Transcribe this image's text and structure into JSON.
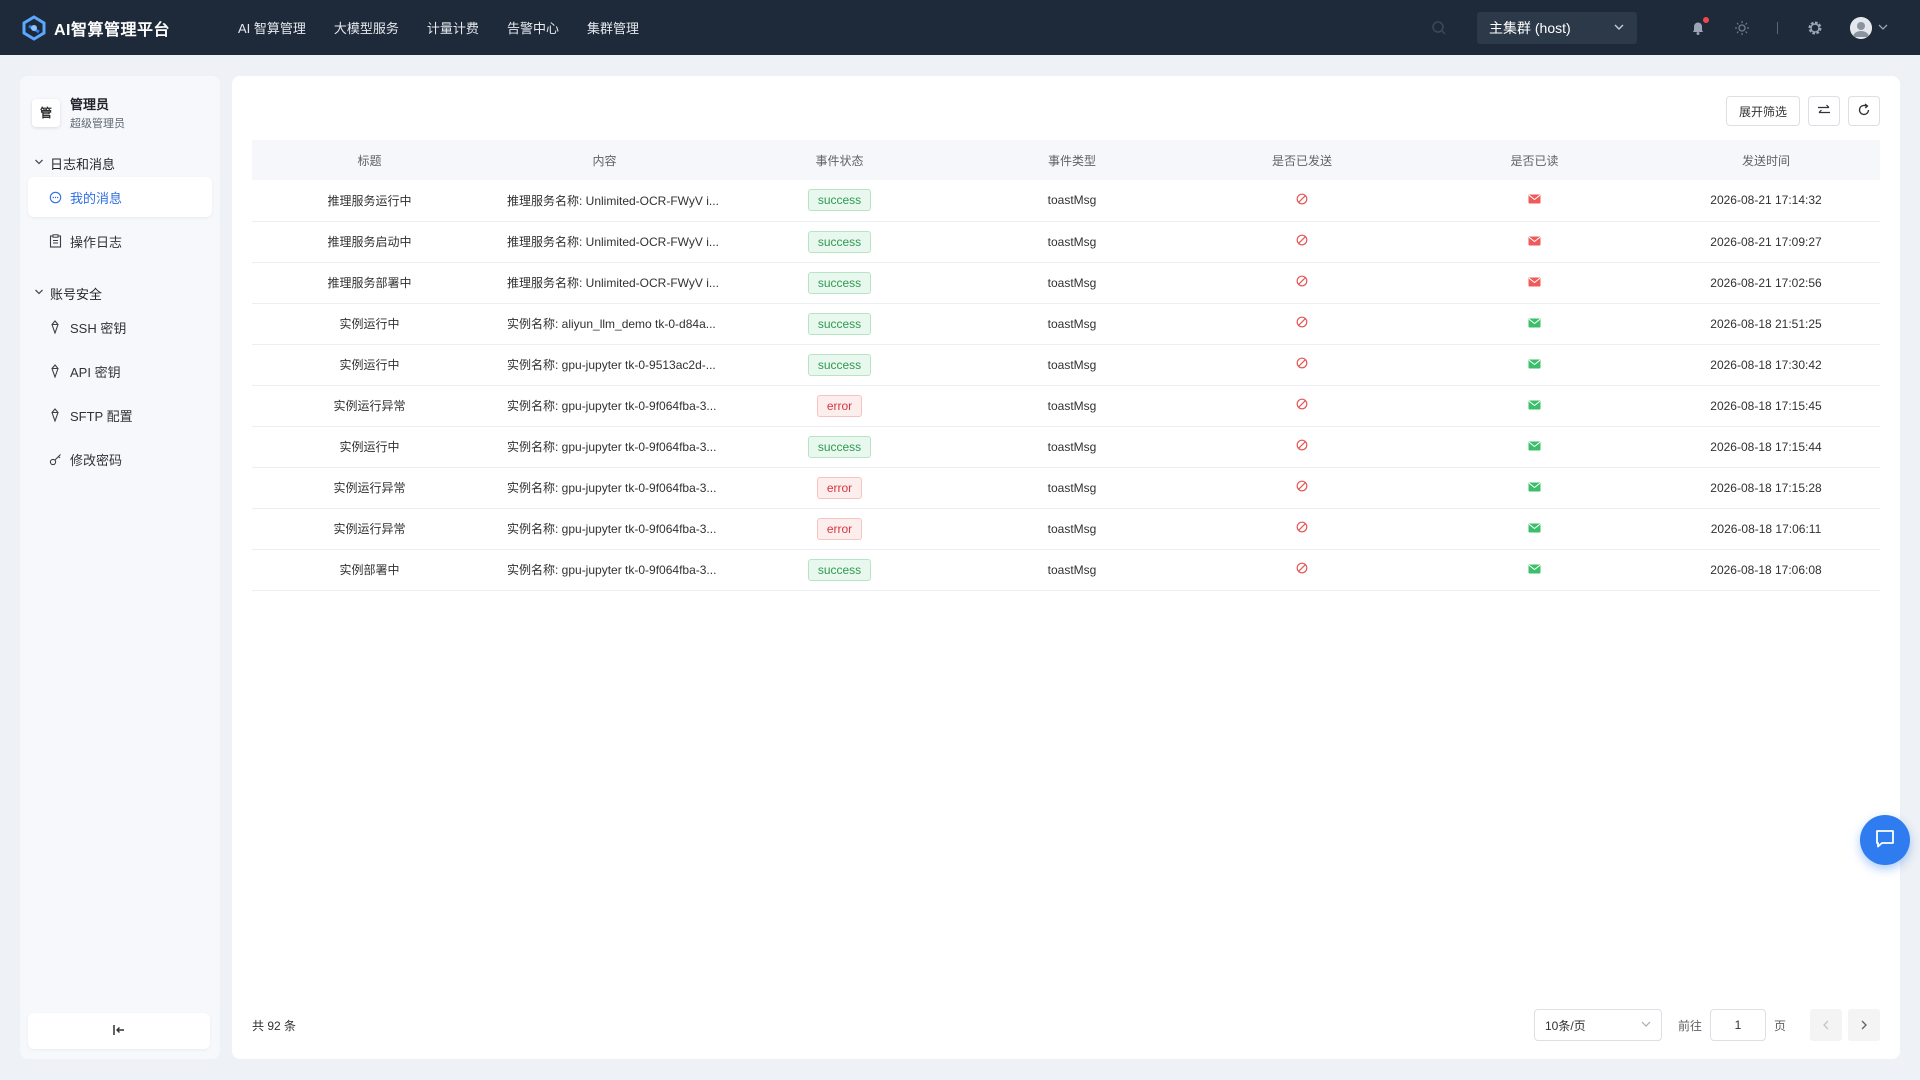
{
  "app": {
    "title": "AI智算管理平台"
  },
  "nav": {
    "items": [
      {
        "label": "AI 智算管理"
      },
      {
        "label": "大模型服务"
      },
      {
        "label": "计量计费"
      },
      {
        "label": "告警中心"
      },
      {
        "label": "集群管理"
      }
    ]
  },
  "topbar": {
    "cluster": "主集群 (host)",
    "has_notification": true
  },
  "sidebar": {
    "profile": {
      "badge": "管",
      "name": "管理员",
      "role": "超级管理员"
    },
    "groups": [
      {
        "title": "日志和消息",
        "items": [
          {
            "label": "我的消息",
            "icon": "message-icon",
            "active": true
          },
          {
            "label": "操作日志",
            "icon": "clipboard-icon",
            "active": false
          }
        ]
      },
      {
        "title": "账号安全",
        "items": [
          {
            "label": "SSH 密钥",
            "icon": "key-icon"
          },
          {
            "label": "API 密钥",
            "icon": "key-icon"
          },
          {
            "label": "SFTP 配置",
            "icon": "key-icon"
          },
          {
            "label": "修改密码",
            "icon": "password-key-icon"
          }
        ]
      }
    ]
  },
  "toolbar": {
    "expand_filter": "展开筛选"
  },
  "table": {
    "columns": [
      "标题",
      "内容",
      "事件状态",
      "事件类型",
      "是否已发送",
      "是否已读",
      "发送时间"
    ],
    "rows": [
      {
        "title": "推理服务运行中",
        "content": "推理服务名称: Unlimited-OCR-FWyV i...",
        "status": "success",
        "type": "toastMsg",
        "sent": "no",
        "read": "unread",
        "time": "2026-08-21 17:14:32"
      },
      {
        "title": "推理服务启动中",
        "content": "推理服务名称: Unlimited-OCR-FWyV i...",
        "status": "success",
        "type": "toastMsg",
        "sent": "no",
        "read": "unread",
        "time": "2026-08-21 17:09:27"
      },
      {
        "title": "推理服务部署中",
        "content": "推理服务名称: Unlimited-OCR-FWyV i...",
        "status": "success",
        "type": "toastMsg",
        "sent": "no",
        "read": "unread",
        "time": "2026-08-21 17:02:56"
      },
      {
        "title": "实例运行中",
        "content": "实例名称: aliyun_llm_demo tk-0-d84a...",
        "status": "success",
        "type": "toastMsg",
        "sent": "no",
        "read": "read",
        "time": "2026-08-18 21:51:25"
      },
      {
        "title": "实例运行中",
        "content": "实例名称: gpu-jupyter tk-0-9513ac2d-...",
        "status": "success",
        "type": "toastMsg",
        "sent": "no",
        "read": "read",
        "time": "2026-08-18 17:30:42"
      },
      {
        "title": "实例运行异常",
        "content": "实例名称: gpu-jupyter tk-0-9f064fba-3...",
        "status": "error",
        "type": "toastMsg",
        "sent": "no",
        "read": "read",
        "time": "2026-08-18 17:15:45"
      },
      {
        "title": "实例运行中",
        "content": "实例名称: gpu-jupyter tk-0-9f064fba-3...",
        "status": "success",
        "type": "toastMsg",
        "sent": "no",
        "read": "read",
        "time": "2026-08-18 17:15:44"
      },
      {
        "title": "实例运行异常",
        "content": "实例名称: gpu-jupyter tk-0-9f064fba-3...",
        "status": "error",
        "type": "toastMsg",
        "sent": "no",
        "read": "read",
        "time": "2026-08-18 17:15:28"
      },
      {
        "title": "实例运行异常",
        "content": "实例名称: gpu-jupyter tk-0-9f064fba-3...",
        "status": "error",
        "type": "toastMsg",
        "sent": "no",
        "read": "read",
        "time": "2026-08-18 17:06:11"
      },
      {
        "title": "实例部署中",
        "content": "实例名称: gpu-jupyter tk-0-9f064fba-3...",
        "status": "success",
        "type": "toastMsg",
        "sent": "no",
        "read": "read",
        "time": "2026-08-18 17:06:08"
      }
    ]
  },
  "footer": {
    "total": "共 92 条",
    "page_size": "10条/页",
    "goto_before": "前往",
    "current_page": "1",
    "goto_after": "页"
  },
  "colors": {
    "topbar": "#1e2a3a",
    "accent": "#2f6fe0",
    "success": "#2e9a4f",
    "error": "#d9363e",
    "unread_mail": "#f05a5a",
    "read_mail": "#3cbf6a"
  }
}
